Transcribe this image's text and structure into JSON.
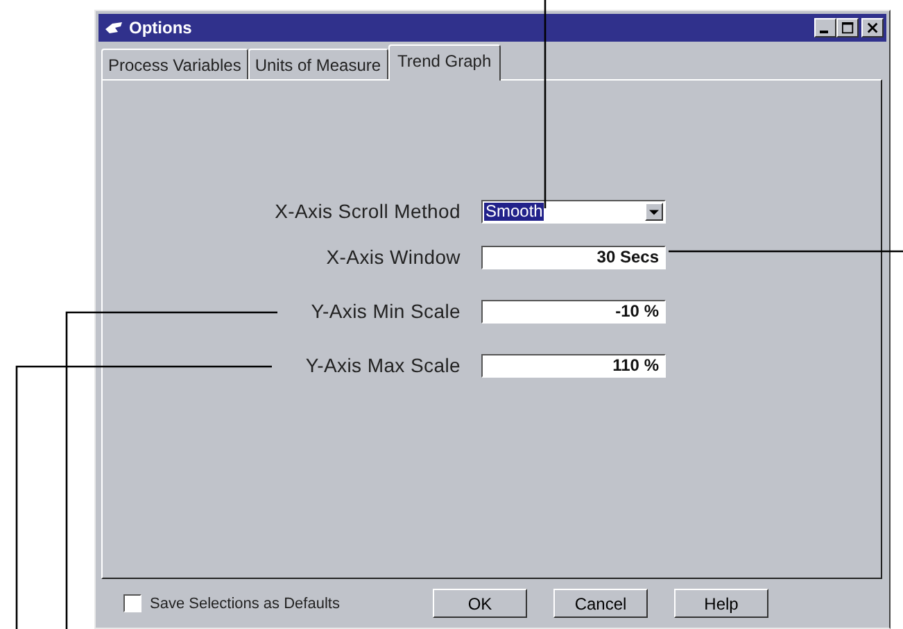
{
  "window": {
    "title": "Options"
  },
  "tabs": [
    {
      "label": "Process Variables",
      "selected": false
    },
    {
      "label": "Units of Measure",
      "selected": false
    },
    {
      "label": "Trend Graph",
      "selected": true
    }
  ],
  "fields": [
    {
      "kind": "dropdown",
      "label": "X-Axis Scroll Method",
      "value": "Smooth"
    },
    {
      "kind": "text",
      "label": "X-Axis Window",
      "value": "30 Secs"
    },
    {
      "kind": "text",
      "label": "Y-Axis Min Scale",
      "value": "-10 %"
    },
    {
      "kind": "text",
      "label": "Y-Axis Max Scale",
      "value": "110 %"
    }
  ],
  "checkbox": {
    "label": "Save Selections as Defaults",
    "checked": false
  },
  "buttons": [
    "OK",
    "Cancel",
    "Help"
  ]
}
